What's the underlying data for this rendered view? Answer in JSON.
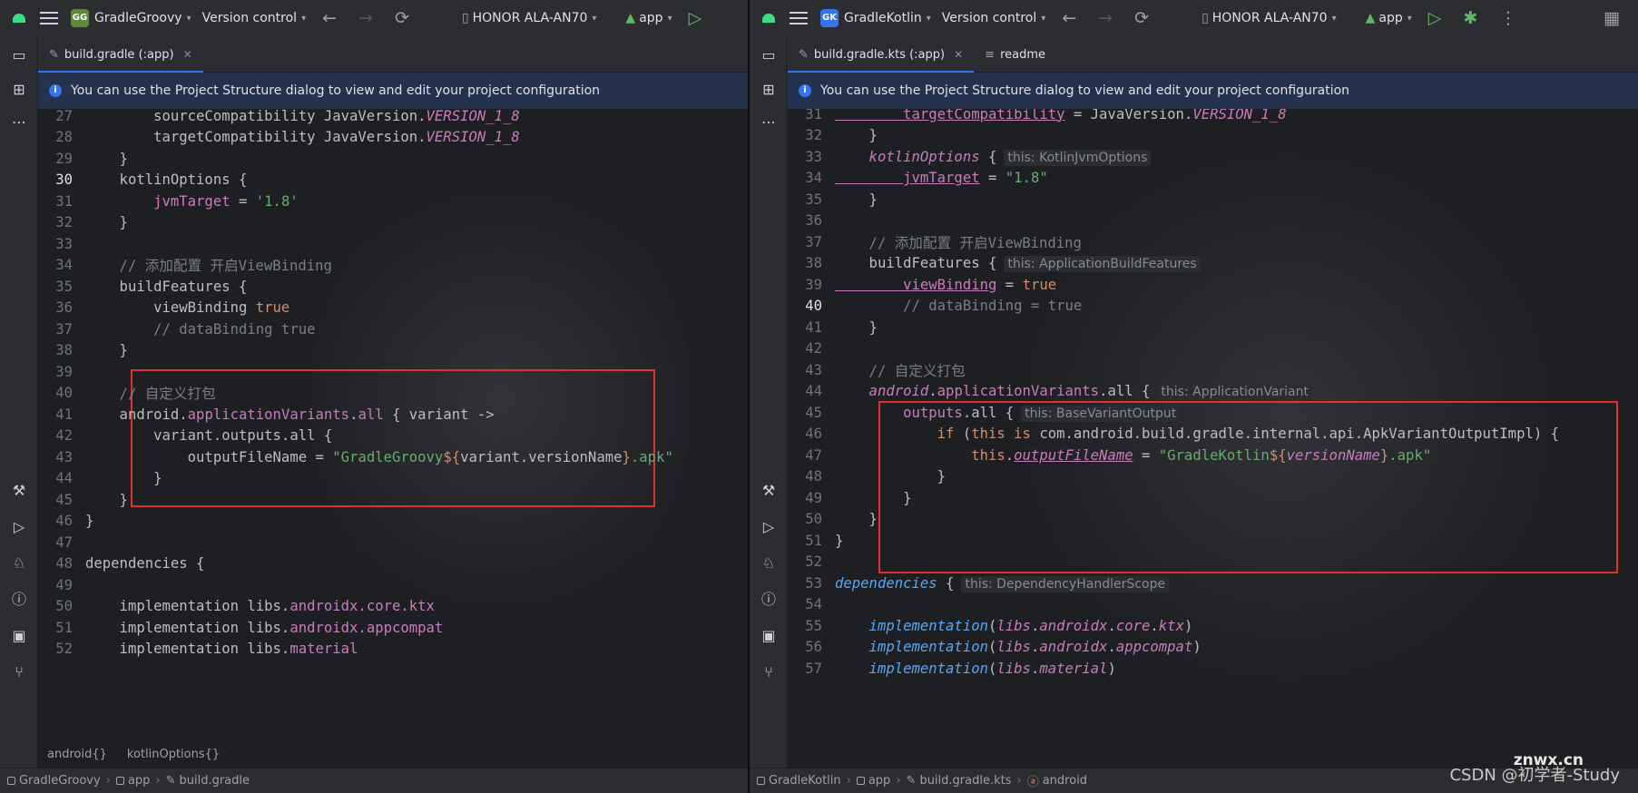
{
  "left": {
    "toolbar": {
      "project_badge": "GG",
      "project": "GradleGroovy",
      "vcs": "Version control",
      "device": "HONOR ALA-AN70",
      "config": "app"
    },
    "tab": {
      "label": "build.gradle (:app)"
    },
    "banner": "You can use the Project Structure dialog to view and edit your project configuration",
    "breadcrumb": [
      "android{}",
      "kotlinOptions{}"
    ],
    "status": [
      "GradleGroovy",
      "app",
      "build.gradle"
    ]
  },
  "right": {
    "toolbar": {
      "project_badge": "GK",
      "project": "GradleKotlin",
      "vcs": "Version control",
      "device": "HONOR ALA-AN70",
      "config": "app"
    },
    "tabs": [
      {
        "label": "build.gradle.kts (:app)"
      },
      {
        "label": "readme"
      }
    ],
    "banner": "You can use the Project Structure dialog to view and edit your project configuration",
    "status": [
      "GradleKotlin",
      "app",
      "build.gradle.kts",
      "android"
    ]
  },
  "code_left": [
    {
      "n": "27",
      "seg": [
        [
          "",
          "        sourceCompatibility JavaVersion."
        ],
        [
          "t-it",
          "VERSION_1_8"
        ]
      ]
    },
    {
      "n": "28",
      "seg": [
        [
          "",
          "        targetCompatibility JavaVersion."
        ],
        [
          "t-it",
          "VERSION_1_8"
        ]
      ]
    },
    {
      "n": "29",
      "seg": [
        [
          "",
          "    }"
        ]
      ]
    },
    {
      "n": "30",
      "cur": true,
      "seg": [
        [
          "",
          "    kotlinOptions {"
        ]
      ]
    },
    {
      "n": "31",
      "seg": [
        [
          "t-prop",
          "        jvmTarget"
        ],
        [
          "",
          " = "
        ],
        [
          "t-str",
          "'1.8'"
        ]
      ]
    },
    {
      "n": "32",
      "seg": [
        [
          "",
          "    }"
        ]
      ]
    },
    {
      "n": "33",
      "seg": []
    },
    {
      "n": "34",
      "seg": [
        [
          "t-cm",
          "    // 添加配置 开启ViewBinding"
        ]
      ]
    },
    {
      "n": "35",
      "seg": [
        [
          "",
          "    buildFeatures {"
        ]
      ]
    },
    {
      "n": "36",
      "seg": [
        [
          "",
          "        viewBinding "
        ],
        [
          "t-kw",
          "true"
        ]
      ]
    },
    {
      "n": "37",
      "seg": [
        [
          "t-cm",
          "        // dataBinding true"
        ]
      ]
    },
    {
      "n": "38",
      "seg": [
        [
          "",
          "    }"
        ]
      ]
    },
    {
      "n": "39",
      "seg": []
    },
    {
      "n": "40",
      "seg": [
        [
          "t-cm",
          "    // 自定义打包"
        ]
      ]
    },
    {
      "n": "41",
      "seg": [
        [
          "",
          "    android."
        ],
        [
          "t-prop",
          "applicationVariants"
        ],
        [
          "",
          "."
        ],
        [
          "t-prop",
          "all"
        ],
        [
          "",
          " { variant ->"
        ]
      ]
    },
    {
      "n": "42",
      "seg": [
        [
          "",
          "        variant.outputs.all {"
        ]
      ]
    },
    {
      "n": "43",
      "seg": [
        [
          "",
          "            outputFileName = "
        ],
        [
          "t-str",
          "\"GradleGroovy"
        ],
        [
          "t-tmpl",
          "${"
        ],
        [
          "",
          "variant.versionName"
        ],
        [
          "t-tmpl",
          "}"
        ],
        [
          "t-str",
          ".apk\""
        ]
      ]
    },
    {
      "n": "44",
      "seg": [
        [
          "",
          "        }"
        ]
      ]
    },
    {
      "n": "45",
      "seg": [
        [
          "",
          "    }"
        ]
      ]
    },
    {
      "n": "46",
      "seg": [
        [
          "",
          "}"
        ]
      ]
    },
    {
      "n": "47",
      "seg": []
    },
    {
      "n": "48",
      "seg": [
        [
          "",
          "dependencies {"
        ]
      ]
    },
    {
      "n": "49",
      "seg": []
    },
    {
      "n": "50",
      "seg": [
        [
          "",
          "    implementation libs."
        ],
        [
          "t-prop",
          "androidx.core.ktx"
        ]
      ]
    },
    {
      "n": "51",
      "seg": [
        [
          "",
          "    implementation libs."
        ],
        [
          "t-prop",
          "androidx.appcompat"
        ]
      ]
    },
    {
      "n": "52",
      "seg": [
        [
          "",
          "    implementation libs."
        ],
        [
          "t-prop",
          "material"
        ]
      ]
    }
  ],
  "code_right": [
    {
      "n": "31",
      "seg": [
        [
          "t-propu",
          "        targetCompatibility"
        ],
        [
          "",
          " = JavaVersion."
        ],
        [
          "t-it",
          "VERSION_1_8"
        ]
      ]
    },
    {
      "n": "32",
      "seg": [
        [
          "",
          "    }"
        ]
      ]
    },
    {
      "n": "33",
      "seg": [
        [
          "t-it",
          "    kotlinOptions"
        ],
        [
          "",
          " {"
        ]
      ],
      "hint": "this: KotlinJvmOptions"
    },
    {
      "n": "34",
      "seg": [
        [
          "t-propu",
          "        jvmTarget"
        ],
        [
          "",
          " = "
        ],
        [
          "t-str",
          "\"1.8\""
        ]
      ]
    },
    {
      "n": "35",
      "seg": [
        [
          "",
          "    }"
        ]
      ]
    },
    {
      "n": "36",
      "seg": []
    },
    {
      "n": "37",
      "seg": [
        [
          "t-cm",
          "    // 添加配置 开启ViewBinding"
        ]
      ]
    },
    {
      "n": "38",
      "seg": [
        [
          "",
          "    buildFeatures {"
        ]
      ],
      "hint": "this: ApplicationBuildFeatures"
    },
    {
      "n": "39",
      "seg": [
        [
          "t-propu",
          "        viewBinding"
        ],
        [
          "",
          " = "
        ],
        [
          "t-kw",
          "true"
        ]
      ]
    },
    {
      "n": "40",
      "cur": true,
      "seg": [
        [
          "t-cm",
          "        // dataBinding = true"
        ]
      ]
    },
    {
      "n": "41",
      "seg": [
        [
          "",
          "    }"
        ]
      ]
    },
    {
      "n": "42",
      "seg": []
    },
    {
      "n": "43",
      "seg": [
        [
          "t-cm",
          "    // 自定义打包"
        ]
      ]
    },
    {
      "n": "44",
      "seg": [
        [
          "t-it",
          "    android"
        ],
        [
          "",
          "."
        ],
        [
          "t-prop",
          "applicationVariants"
        ],
        [
          "",
          ".all {"
        ]
      ],
      "hint": "this: ApplicationVariant"
    },
    {
      "n": "45",
      "seg": [
        [
          "t-prop",
          "        outputs"
        ],
        [
          "",
          ".all {"
        ]
      ],
      "hint": "this: BaseVariantOutput"
    },
    {
      "n": "46",
      "seg": [
        [
          "t-kw",
          "            if"
        ],
        [
          "",
          " ("
        ],
        [
          "t-kw",
          "this is"
        ],
        [
          "",
          " com.android.build.gradle.internal.api.ApkVariantOutputImpl) {"
        ]
      ]
    },
    {
      "n": "47",
      "seg": [
        [
          "t-kw",
          "                this"
        ],
        [
          "",
          "."
        ],
        [
          "t-itu",
          "outputFileName"
        ],
        [
          "",
          " = "
        ],
        [
          "t-str",
          "\"GradleKotlin"
        ],
        [
          "t-tmpl",
          "${"
        ],
        [
          "t-it",
          "versionName"
        ],
        [
          "t-tmpl",
          "}"
        ],
        [
          "t-str",
          ".apk\""
        ]
      ]
    },
    {
      "n": "48",
      "seg": [
        [
          "",
          "            }"
        ]
      ]
    },
    {
      "n": "49",
      "seg": [
        [
          "",
          "        }"
        ]
      ]
    },
    {
      "n": "50",
      "seg": [
        [
          "",
          "    }"
        ]
      ]
    },
    {
      "n": "51",
      "seg": [
        [
          "",
          "}"
        ]
      ]
    },
    {
      "n": "52",
      "seg": []
    },
    {
      "n": "53",
      "seg": [
        [
          "t-kt",
          "dependencies"
        ],
        [
          "",
          " {"
        ]
      ],
      "hint": "this: DependencyHandlerScope"
    },
    {
      "n": "54",
      "seg": []
    },
    {
      "n": "55",
      "seg": [
        [
          "t-kt",
          "    implementation"
        ],
        [
          "",
          "("
        ],
        [
          "t-it",
          "libs"
        ],
        [
          "",
          "."
        ],
        [
          "t-it",
          "androidx"
        ],
        [
          "",
          "."
        ],
        [
          "t-it",
          "core"
        ],
        [
          "",
          "."
        ],
        [
          "t-it",
          "ktx"
        ],
        [
          "",
          ")"
        ]
      ]
    },
    {
      "n": "56",
      "seg": [
        [
          "t-kt",
          "    implementation"
        ],
        [
          "",
          "("
        ],
        [
          "t-it",
          "libs"
        ],
        [
          "",
          "."
        ],
        [
          "t-it",
          "androidx"
        ],
        [
          "",
          "."
        ],
        [
          "t-it",
          "appcompat"
        ],
        [
          "",
          ")"
        ]
      ]
    },
    {
      "n": "57",
      "seg": [
        [
          "t-kt",
          "    implementation"
        ],
        [
          "",
          "("
        ],
        [
          "t-it",
          "libs"
        ],
        [
          "",
          "."
        ],
        [
          "t-it",
          "material"
        ],
        [
          "",
          ")"
        ]
      ]
    }
  ],
  "watermark": "CSDN @初学者-Study",
  "watermark2": "znwx.cn"
}
